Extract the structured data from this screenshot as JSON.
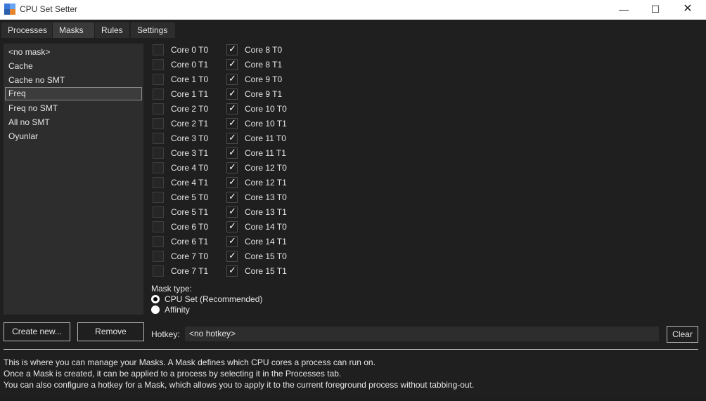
{
  "window": {
    "title": "CPU Set Setter",
    "minimize_glyph": "—",
    "maximize_glyph": "☐",
    "close_glyph": "✕"
  },
  "tabs": [
    {
      "label": "Processes",
      "active": false
    },
    {
      "label": "Masks",
      "active": true
    },
    {
      "label": "Rules",
      "active": false
    },
    {
      "label": "Settings",
      "active": false
    }
  ],
  "masks": {
    "items": [
      "<no mask>",
      "Cache",
      "Cache no SMT",
      "Freq",
      "Freq no SMT",
      "All no SMT",
      "Oyunlar"
    ],
    "selected_index": 3
  },
  "cores": {
    "left": [
      {
        "label": "Core 0 T0",
        "checked": false
      },
      {
        "label": "Core 0 T1",
        "checked": false
      },
      {
        "label": "Core 1 T0",
        "checked": false
      },
      {
        "label": "Core 1 T1",
        "checked": false
      },
      {
        "label": "Core 2 T0",
        "checked": false
      },
      {
        "label": "Core 2 T1",
        "checked": false
      },
      {
        "label": "Core 3 T0",
        "checked": false
      },
      {
        "label": "Core 3 T1",
        "checked": false
      },
      {
        "label": "Core 4 T0",
        "checked": false
      },
      {
        "label": "Core 4 T1",
        "checked": false
      },
      {
        "label": "Core 5 T0",
        "checked": false
      },
      {
        "label": "Core 5 T1",
        "checked": false
      },
      {
        "label": "Core 6 T0",
        "checked": false
      },
      {
        "label": "Core 6 T1",
        "checked": false
      },
      {
        "label": "Core 7 T0",
        "checked": false
      },
      {
        "label": "Core 7 T1",
        "checked": false
      }
    ],
    "right": [
      {
        "label": "Core 8 T0",
        "checked": true
      },
      {
        "label": "Core 8 T1",
        "checked": true
      },
      {
        "label": "Core 9 T0",
        "checked": true
      },
      {
        "label": "Core 9 T1",
        "checked": true
      },
      {
        "label": "Core 10 T0",
        "checked": true
      },
      {
        "label": "Core 10 T1",
        "checked": true
      },
      {
        "label": "Core 11 T0",
        "checked": true
      },
      {
        "label": "Core 11 T1",
        "checked": true
      },
      {
        "label": "Core 12 T0",
        "checked": true
      },
      {
        "label": "Core 12 T1",
        "checked": true
      },
      {
        "label": "Core 13 T0",
        "checked": true
      },
      {
        "label": "Core 13 T1",
        "checked": true
      },
      {
        "label": "Core 14 T0",
        "checked": true
      },
      {
        "label": "Core 14 T1",
        "checked": true
      },
      {
        "label": "Core 15 T0",
        "checked": true
      },
      {
        "label": "Core 15 T1",
        "checked": true
      }
    ],
    "check_glyph": "✓"
  },
  "mask_type": {
    "label": "Mask type:",
    "options": [
      {
        "label": "CPU Set (Recommended)",
        "selected": true
      },
      {
        "label": "Affinity",
        "selected": false
      }
    ]
  },
  "buttons": {
    "create_new": "Create new...",
    "remove": "Remove",
    "clear": "Clear"
  },
  "hotkey": {
    "label": "Hotkey:",
    "value": "<no hotkey>"
  },
  "help": [
    "This is where you can manage your Masks. A Mask defines which CPU cores a process can run on.",
    "Once a Mask is created, it can be applied to a process by selecting it in the Processes tab.",
    "You can also configure a hotkey for a Mask, which allows you to apply it to the current foreground process without tabbing-out."
  ]
}
